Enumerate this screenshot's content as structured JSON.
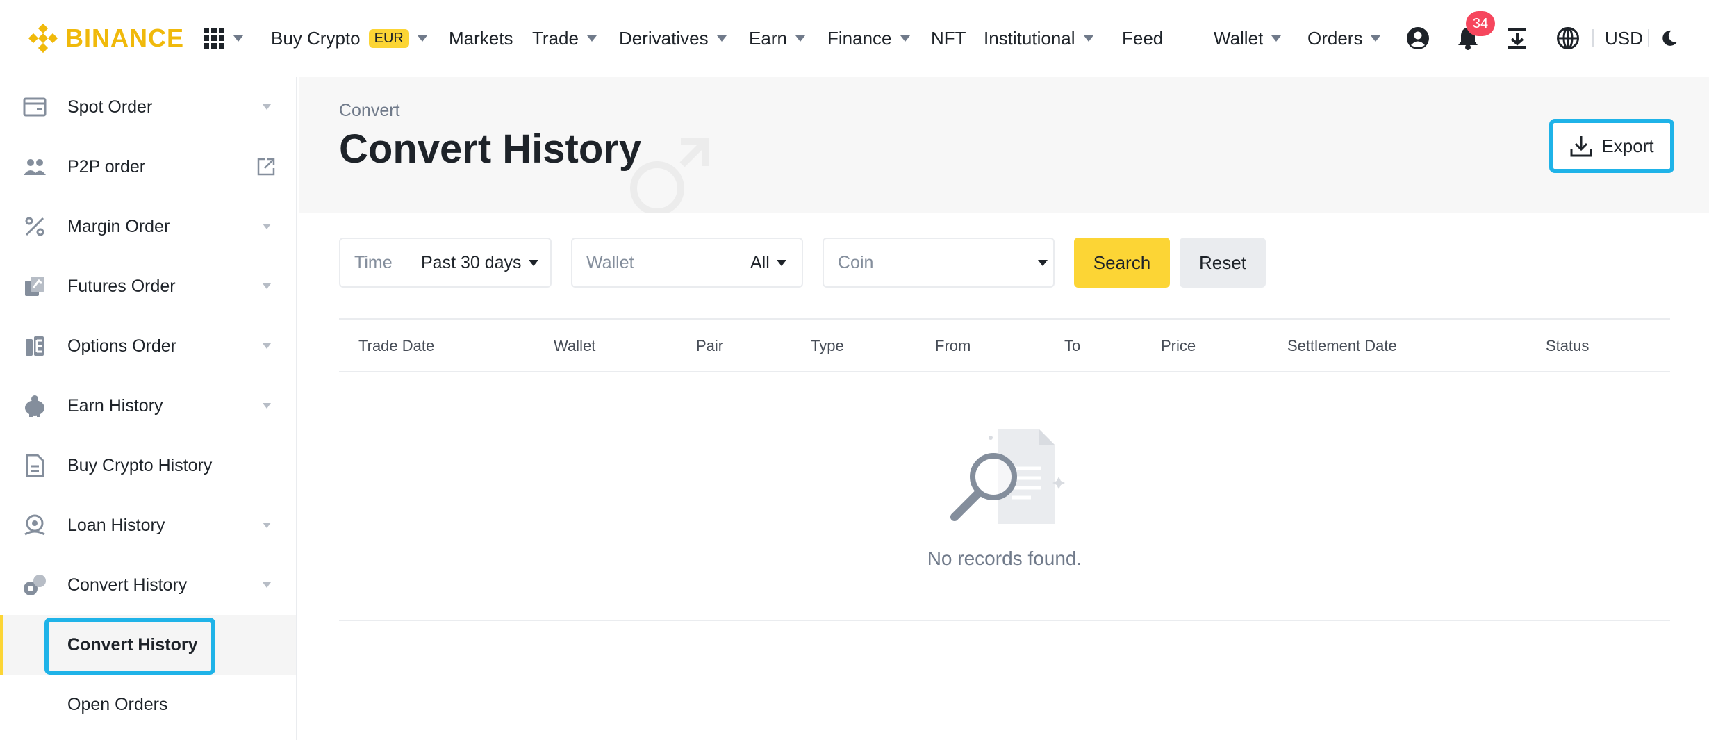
{
  "brand": {
    "name": "BINANCE",
    "color": "#f0b90b"
  },
  "topnav": {
    "items": [
      {
        "label": "Buy Crypto",
        "badge": "EUR"
      },
      {
        "label": "Markets"
      },
      {
        "label": "Trade"
      },
      {
        "label": "Derivatives"
      },
      {
        "label": "Earn"
      },
      {
        "label": "Finance"
      },
      {
        "label": "NFT"
      },
      {
        "label": "Institutional"
      },
      {
        "label": "Feed"
      },
      {
        "label": "Wallet"
      },
      {
        "label": "Orders"
      }
    ],
    "notification_count": "34",
    "currency": "USD"
  },
  "sidebar": {
    "items": [
      {
        "label": "Spot Order",
        "icon": "wallet-icon"
      },
      {
        "label": "P2P order",
        "icon": "users-icon"
      },
      {
        "label": "Margin Order",
        "icon": "percent-icon"
      },
      {
        "label": "Futures Order",
        "icon": "futures-icon"
      },
      {
        "label": "Options Order",
        "icon": "options-icon"
      },
      {
        "label": "Earn History",
        "icon": "piggy-bank-icon"
      },
      {
        "label": "Buy Crypto History",
        "icon": "document-icon"
      },
      {
        "label": "Loan History",
        "icon": "loan-icon"
      },
      {
        "label": "Convert History",
        "icon": "convert-icon"
      }
    ],
    "subitems": [
      {
        "label": "Convert History",
        "active": true
      },
      {
        "label": "Open Orders"
      }
    ]
  },
  "header": {
    "breadcrumb": "Convert",
    "title": "Convert History",
    "export_label": "Export"
  },
  "filters": {
    "time": {
      "label": "Time",
      "value": "Past 30 days"
    },
    "wallet": {
      "label": "Wallet",
      "value": "All"
    },
    "coin": {
      "placeholder": "Coin"
    },
    "search_label": "Search",
    "reset_label": "Reset"
  },
  "table": {
    "columns": [
      "Trade Date",
      "Wallet",
      "Pair",
      "Type",
      "From",
      "To",
      "Price",
      "Settlement Date",
      "Status"
    ],
    "empty_text": "No records found."
  },
  "colors": {
    "accent": "#fcd535",
    "highlight": "#1fb3e8",
    "badge": "#f6465d"
  }
}
